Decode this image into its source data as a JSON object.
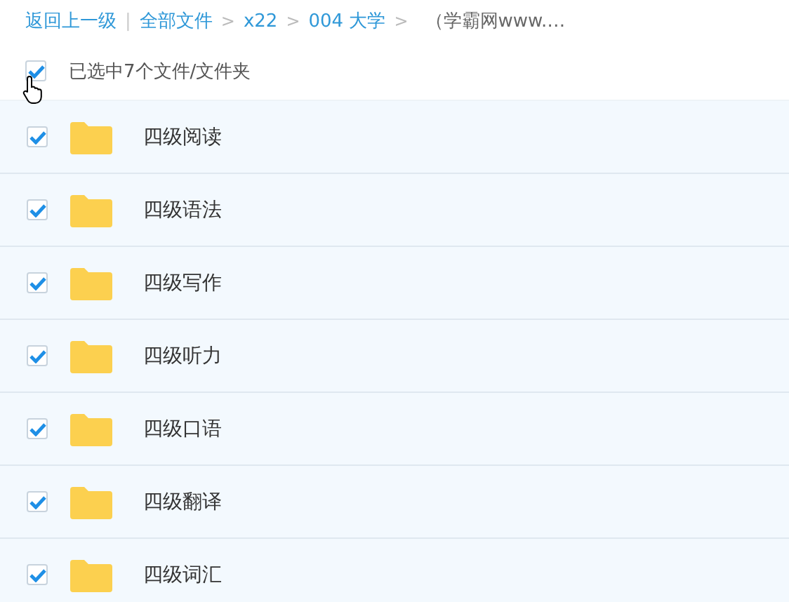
{
  "breadcrumb": {
    "back": "返回上一级",
    "divider": "|",
    "crumbs": [
      {
        "label": "全部文件",
        "current": false,
        "sep": ">"
      },
      {
        "label": "x22",
        "current": false,
        "sep": ">"
      },
      {
        "label": "004 大学",
        "current": false,
        "sep": ">"
      },
      {
        "label": "（学霸网www.…",
        "current": true
      }
    ]
  },
  "select_all": {
    "checked": true,
    "label": "已选中7个文件/文件夹"
  },
  "files": [
    {
      "name": "四级阅读",
      "checked": true
    },
    {
      "name": "四级语法",
      "checked": true
    },
    {
      "name": "四级写作",
      "checked": true
    },
    {
      "name": "四级听力",
      "checked": true
    },
    {
      "name": "四级口语",
      "checked": true
    },
    {
      "name": "四级翻译",
      "checked": true
    },
    {
      "name": "四级词汇",
      "checked": true
    }
  ]
}
